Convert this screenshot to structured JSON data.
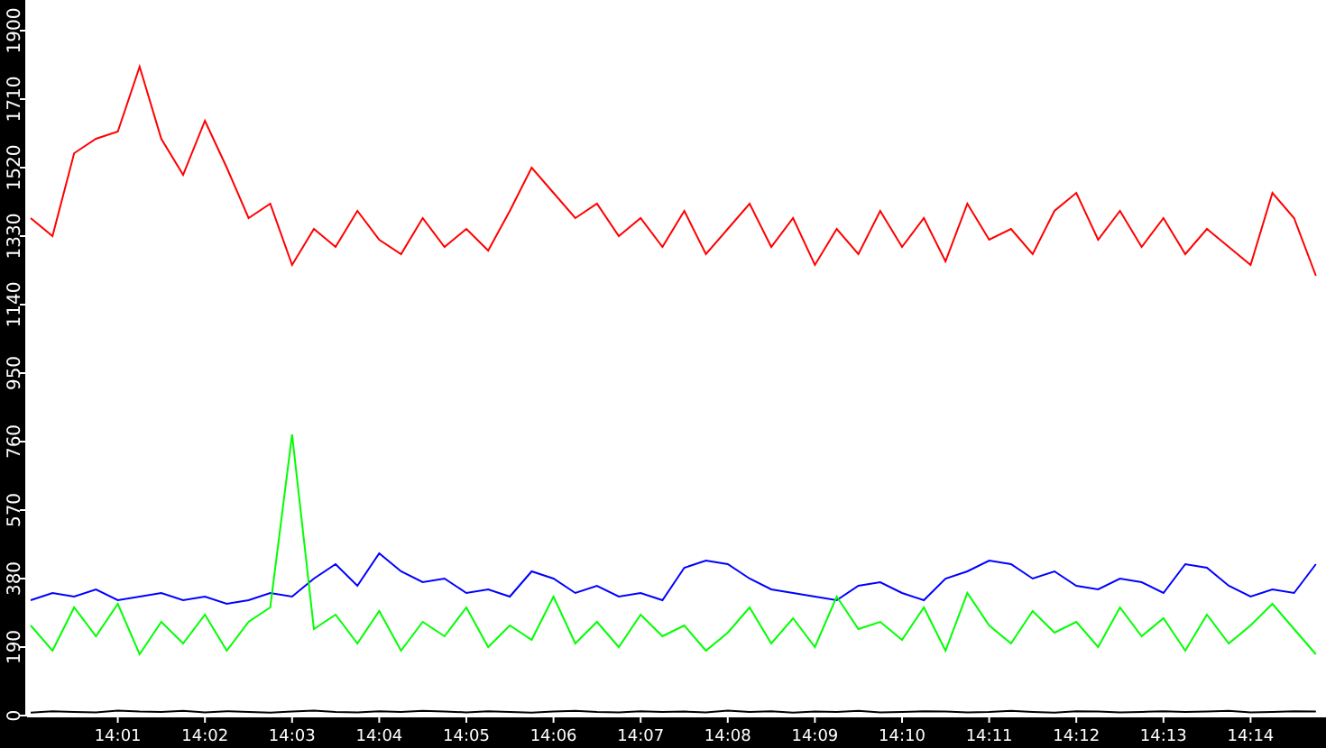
{
  "chart_data": {
    "type": "line",
    "categories": [
      null,
      null,
      null,
      null,
      "14:01",
      null,
      null,
      null,
      "14:02",
      null,
      null,
      null,
      "14:03",
      null,
      null,
      null,
      "14:04",
      null,
      null,
      null,
      "14:05",
      null,
      null,
      null,
      "14:06",
      null,
      null,
      null,
      "14:07",
      null,
      null,
      null,
      "14:08",
      null,
      null,
      null,
      "14:09",
      null,
      null,
      null,
      "14:10",
      null,
      null,
      null,
      "14:11",
      null,
      null,
      null,
      "14:12",
      null,
      null,
      null,
      "14:13",
      null,
      null,
      null,
      "14:14",
      null,
      null,
      null
    ],
    "series": [
      {
        "color": "#ff0000",
        "values": [
          1380,
          1330,
          1560,
          1600,
          1620,
          1800,
          1600,
          1500,
          1650,
          1520,
          1380,
          1420,
          1250,
          1350,
          1300,
          1400,
          1320,
          1280,
          1380,
          1300,
          1350,
          1290,
          1400,
          1520,
          1450,
          1380,
          1420,
          1330,
          1380,
          1300,
          1400,
          1280,
          1350,
          1420,
          1300,
          1380,
          1250,
          1350,
          1280,
          1400,
          1300,
          1380,
          1260,
          1420,
          1320,
          1350,
          1280,
          1400,
          1450,
          1320,
          1400,
          1300,
          1380,
          1280,
          1350,
          1300,
          1250,
          1450,
          1380,
          1220
        ]
      },
      {
        "color": "#0000ff",
        "values": [
          320,
          340,
          330,
          350,
          320,
          330,
          340,
          320,
          330,
          310,
          320,
          340,
          330,
          380,
          420,
          360,
          450,
          400,
          370,
          380,
          340,
          350,
          330,
          400,
          380,
          340,
          360,
          330,
          340,
          320,
          410,
          430,
          420,
          380,
          350,
          340,
          330,
          320,
          360,
          370,
          340,
          320,
          380,
          400,
          430,
          420,
          380,
          400,
          360,
          350,
          380,
          370,
          340,
          420,
          410,
          360,
          330,
          350,
          340,
          420
        ]
      },
      {
        "color": "#00ff00",
        "values": [
          250,
          180,
          300,
          220,
          310,
          170,
          260,
          200,
          280,
          180,
          260,
          300,
          780,
          240,
          280,
          200,
          290,
          180,
          260,
          220,
          300,
          190,
          250,
          210,
          330,
          200,
          260,
          190,
          280,
          220,
          250,
          180,
          230,
          300,
          200,
          270,
          190,
          330,
          240,
          260,
          210,
          300,
          180,
          340,
          250,
          200,
          290,
          230,
          260,
          190,
          300,
          220,
          270,
          180,
          280,
          200,
          250,
          310,
          240,
          170
        ]
      },
      {
        "color": "#000000",
        "values": [
          8,
          12,
          10,
          9,
          14,
          11,
          10,
          13,
          9,
          12,
          10,
          8,
          11,
          14,
          10,
          9,
          12,
          10,
          13,
          11,
          9,
          12,
          10,
          8,
          11,
          13,
          10,
          9,
          12,
          10,
          11,
          9,
          14,
          10,
          12,
          8,
          11,
          10,
          13,
          9,
          10,
          12,
          11,
          9,
          10,
          13,
          10,
          8,
          12,
          11,
          9,
          10,
          12,
          10,
          11,
          13,
          9,
          10,
          12,
          11
        ]
      }
    ],
    "ylim": [
      0,
      1985
    ],
    "yticks": [
      0,
      190,
      380,
      570,
      760,
      950,
      1140,
      1330,
      1520,
      1710,
      1900
    ]
  }
}
